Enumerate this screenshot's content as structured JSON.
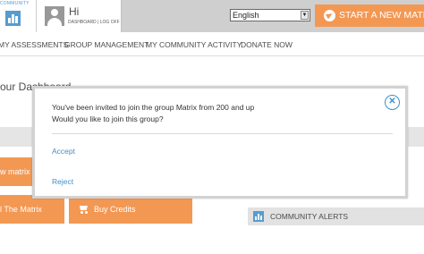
{
  "header": {
    "logo_text": "COMMUNITY",
    "greeting": "Hi",
    "user_links": "DASHBOARD | LOG OFF",
    "language": "English",
    "start_button": "START A NEW MATRIX"
  },
  "nav": {
    "items": [
      "My Assessments",
      "Group Management",
      "My Community Activity",
      "Donate Now"
    ]
  },
  "page": {
    "heading": "our Dashboard"
  },
  "tiles": {
    "new_matrix": "w matrix",
    "the_matrix": "l The Matrix",
    "buy_credits": "Buy Credits"
  },
  "alerts": {
    "title": "Community Alerts"
  },
  "modal": {
    "line1": "You've been invited to join the group Matrix from 200 and up",
    "line2": "Would you like to join this group?",
    "accept": "Accept",
    "reject": "Reject",
    "close_symbol": "✕"
  },
  "colors": {
    "accent_orange": "#f28a3c",
    "accent_blue": "#3f8fc9",
    "topbar_grey": "#c9c9c9"
  }
}
